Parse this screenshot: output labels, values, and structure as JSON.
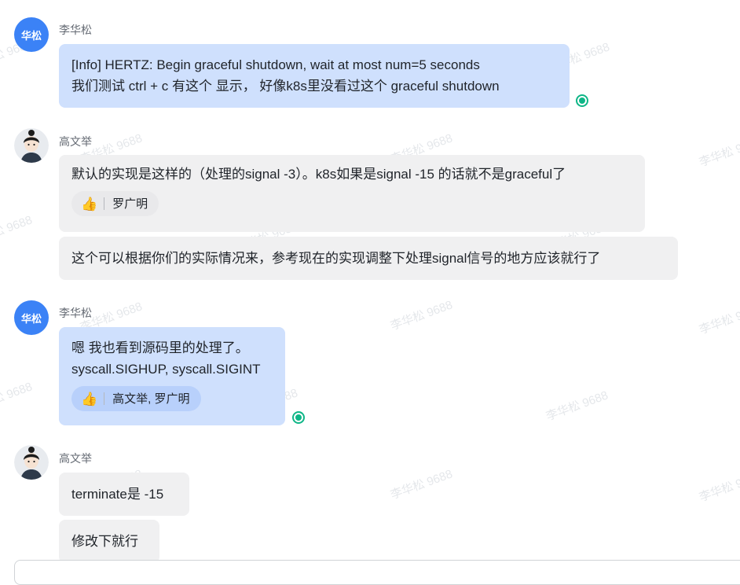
{
  "watermark": "李华松 9688",
  "colors": {
    "my_bubble": "#cfe0fd",
    "other_bubble": "#f0f0f1",
    "read_indicator": "#0fb687",
    "avatar_blue": "#3b82f6"
  },
  "messages": [
    {
      "sender": "李华松",
      "avatar_text": "华松",
      "bubbles": [
        {
          "lines": [
            "[Info] HERTZ: Begin graceful shutdown, wait at most num=5 seconds",
            "我们测试 ctrl + c 有这个 显示， 好像k8s里没看过这个 graceful shutdown"
          ]
        }
      ]
    },
    {
      "sender": "高文举",
      "bubbles": [
        {
          "lines": [
            "默认的实现是这样的（处理的signal -3）。k8s如果是signal -15 的话就不是graceful了"
          ],
          "reaction": {
            "icon": "thumbs-up-icon",
            "users": "罗广明"
          }
        },
        {
          "lines": [
            "这个可以根据你们的实际情况来，参考现在的实现调整下处理signal信号的地方应该就行了"
          ]
        }
      ]
    },
    {
      "sender": "李华松",
      "avatar_text": "华松",
      "bubbles": [
        {
          "lines": [
            "嗯 我也看到源码里的处理了。",
            "syscall.SIGHUP, syscall.SIGINT"
          ],
          "reaction": {
            "icon": "thumbs-up-icon",
            "users": "高文举, 罗广明"
          }
        }
      ]
    },
    {
      "sender": "高文举",
      "bubbles": [
        {
          "lines": [
            "terminate是 -15"
          ]
        },
        {
          "lines": [
            "修改下就行"
          ]
        }
      ]
    }
  ]
}
